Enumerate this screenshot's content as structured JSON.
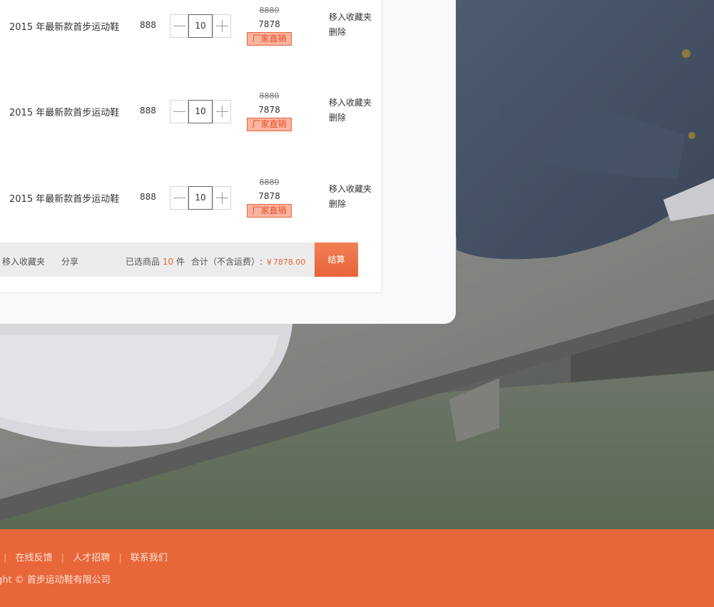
{
  "cart": {
    "items": [
      {
        "name": "2015 年最新款首步运动鞋",
        "price": "888",
        "qty": "10",
        "old_price": "8880",
        "new_price": "7878",
        "badge": "厂家直销",
        "move_label": "移入收藏夹",
        "delete_label": "删除"
      },
      {
        "name": "2015 年最新款首步运动鞋",
        "price": "888",
        "qty": "10",
        "old_price": "8880",
        "new_price": "7878",
        "badge": "厂家直销",
        "move_label": "移入收藏夹",
        "delete_label": "删除"
      },
      {
        "name": "2015 年最新款首步运动鞋",
        "price": "888",
        "qty": "10",
        "old_price": "8880",
        "new_price": "7878",
        "badge": "厂家直销",
        "move_label": "移入收藏夹",
        "delete_label": "删除"
      }
    ],
    "summary": {
      "fav_label": "移入收藏夹",
      "share_label": "分享",
      "selected_prefix": "已选商品",
      "selected_count": "10",
      "selected_unit": "件",
      "total_label": "合计（不含运费）:",
      "total_amount": "￥7878.00",
      "checkout_label": "结算"
    }
  },
  "footer": {
    "links": [
      "在线反馈",
      "人才招聘",
      "联系我们"
    ],
    "copyright": "right © 首步运动鞋有限公司"
  },
  "colors": {
    "accent": "#e8673a",
    "badge_bg": "#f9b4a1",
    "panel_bg": "#f8f9fb"
  },
  "icons": {
    "minus": "minus-icon",
    "plus": "plus-icon"
  }
}
